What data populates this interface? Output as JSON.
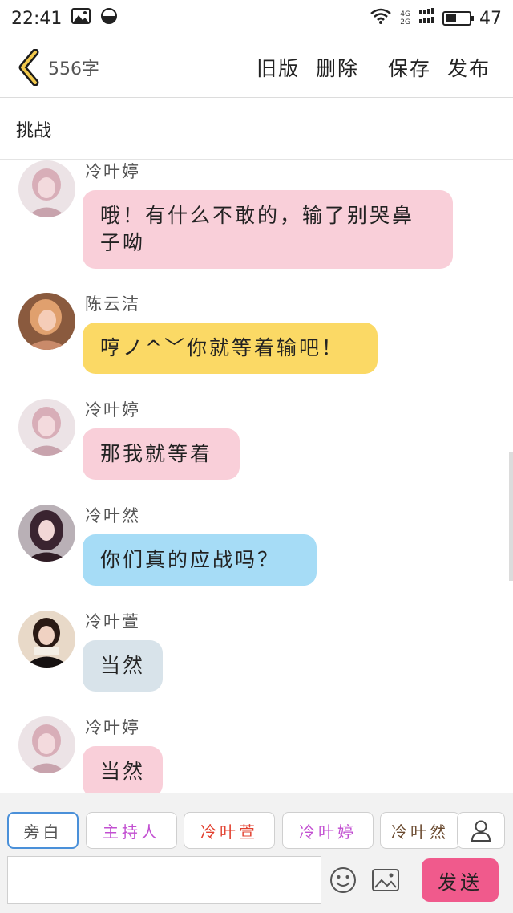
{
  "status_bar": {
    "time": "22:41",
    "network_top": "4G",
    "network_bottom": "2G",
    "battery_level": "47",
    "battery_fraction": 0.47
  },
  "header": {
    "back_icon": "chevron-left-icon",
    "word_count": "556字",
    "actions": [
      "旧版",
      "删除",
      "保存",
      "发布"
    ]
  },
  "title": "挑战",
  "messages": [
    {
      "sender": "冷叶婷",
      "text": "哦！有什么不敢的，输了别哭鼻子呦",
      "color": "#f9cfd9"
    },
    {
      "sender": "陈云洁",
      "text": "哼ノ^﹀你就等着输吧！",
      "color": "#fbd965"
    },
    {
      "sender": "冷叶婷",
      "text": "那我就等着",
      "color": "#f9cfd9"
    },
    {
      "sender": "冷叶然",
      "text": "你们真的应战吗？",
      "color": "#a6dcf6"
    },
    {
      "sender": "冷叶萱",
      "text": "当然",
      "color": "#d8e3ea"
    },
    {
      "sender": "冷叶婷",
      "text": "当然",
      "color": "#f9cfd9"
    }
  ],
  "roles": [
    {
      "label": "旁白",
      "color": "#555555"
    },
    {
      "label": "主持人",
      "color": "#c24fd1"
    },
    {
      "label": "冷叶萱",
      "color": "#e2402f"
    },
    {
      "label": "冷叶婷",
      "color": "#c24fd1"
    },
    {
      "label": "冷叶然",
      "color": "#6a4a2f"
    }
  ],
  "composer": {
    "input_value": "",
    "send_label": "发送",
    "accent_color": "#f05a8c"
  }
}
